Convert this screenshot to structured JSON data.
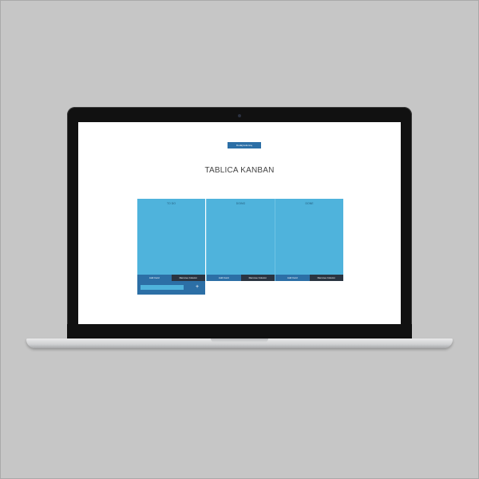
{
  "app": {
    "add_column_label": "Dodaj kolumnę",
    "board_title": "TABLICA KANBAN"
  },
  "columns": [
    {
      "title": "TO DO",
      "add_card_label": "Add Card",
      "remove_label": "Remove Column"
    },
    {
      "title": "DOING",
      "add_card_label": "Add Card",
      "remove_label": "Remove Column"
    },
    {
      "title": "DONE",
      "add_card_label": "Add Card",
      "remove_label": "Remove Column"
    }
  ],
  "new_card": {
    "value": "",
    "plus_label": "+"
  },
  "colors": {
    "column_bg": "#4fb3dc",
    "primary": "#2c6fa6",
    "dark": "#2a3441",
    "background": "#c6c6c6"
  }
}
